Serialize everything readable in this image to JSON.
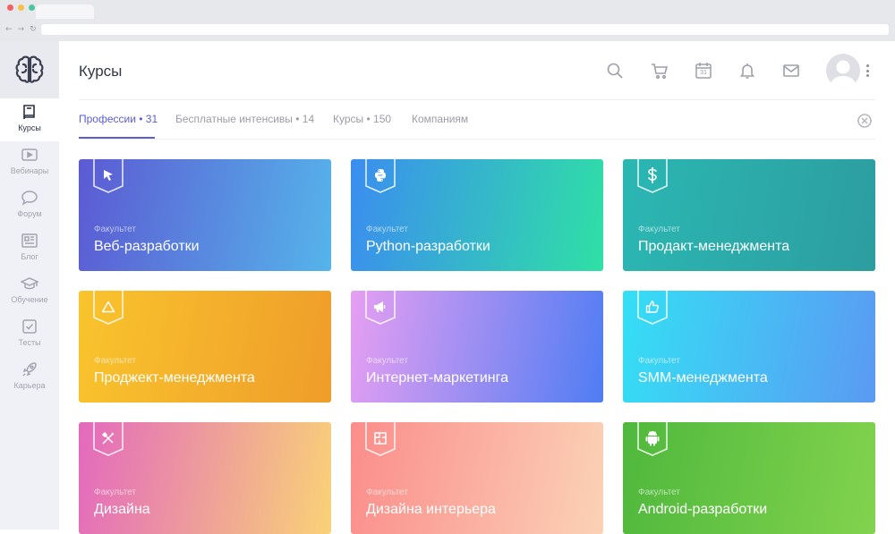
{
  "browser": {
    "nav_buttons": [
      "←",
      "→",
      "↻"
    ],
    "colors": {
      "close": "#f46060",
      "minimize": "#f7c04a",
      "maximize": "#4cc6a0"
    }
  },
  "sidebar": {
    "logo": "brain-logo",
    "items": [
      {
        "label": "Курсы",
        "icon": "book-icon",
        "active": true
      },
      {
        "label": "Вебинары",
        "icon": "play-icon"
      },
      {
        "label": "Форум",
        "icon": "chat-bubble-icon"
      },
      {
        "label": "Блог",
        "icon": "newspaper-icon"
      },
      {
        "label": "Обучение",
        "icon": "graduation-cap-icon"
      },
      {
        "label": "Тесты",
        "icon": "checkbox-icon"
      },
      {
        "label": "Карьера",
        "icon": "rocket-icon"
      }
    ]
  },
  "header": {
    "title": "Курсы",
    "icons": [
      "search-icon",
      "cart-icon",
      "calendar-icon",
      "bell-icon",
      "mail-icon"
    ],
    "calendar_day": "31"
  },
  "tabs": [
    {
      "label": "Профессии • 31",
      "active": true
    },
    {
      "label": "Бесплатные интенсивы • 14"
    },
    {
      "label": "Курсы • 150"
    },
    {
      "label": "Компаниям"
    }
  ],
  "accent_color": "#5b5fd0",
  "cards": [
    {
      "label": "Факультет",
      "name": "Веб-разработки",
      "icon": "cursor-icon",
      "gradient": [
        "#5c5ad3",
        "#55b4ea"
      ]
    },
    {
      "label": "Факультет",
      "name": "Python-разработки",
      "icon": "python-icon",
      "gradient": [
        "#3b8df0",
        "#2fe0a5"
      ]
    },
    {
      "label": "Факультет",
      "name": "Продакт-менеджмента",
      "icon": "dollar-icon",
      "gradient": [
        "#2bb7b3",
        "#2c9da0"
      ]
    },
    {
      "label": "Факультет",
      "name": "Проджект-менеджмента",
      "icon": "triangle-icon",
      "gradient": [
        "#f9c42d",
        "#ef9d2a"
      ]
    },
    {
      "label": "Факультет",
      "name": "Интернет-маркетинга",
      "icon": "megaphone-icon",
      "gradient": [
        "#e69ff2",
        "#4f7df3"
      ]
    },
    {
      "label": "Факультет",
      "name": "SMM-менеджмента",
      "icon": "thumbs-up-icon",
      "gradient": [
        "#34dff5",
        "#5b9af3"
      ]
    },
    {
      "label": "Факультет",
      "name": "Дизайна",
      "icon": "design-tools-icon",
      "gradient": [
        "#e369be",
        "#f9d277"
      ]
    },
    {
      "label": "Факультет",
      "name": "Дизайна интерьера",
      "icon": "floor-plan-icon",
      "gradient": [
        "#fb8d8b",
        "#fbd2b6"
      ]
    },
    {
      "label": "Факультет",
      "name": "Android-разработки",
      "icon": "android-icon",
      "gradient": [
        "#4fb83d",
        "#82d34d"
      ]
    }
  ]
}
